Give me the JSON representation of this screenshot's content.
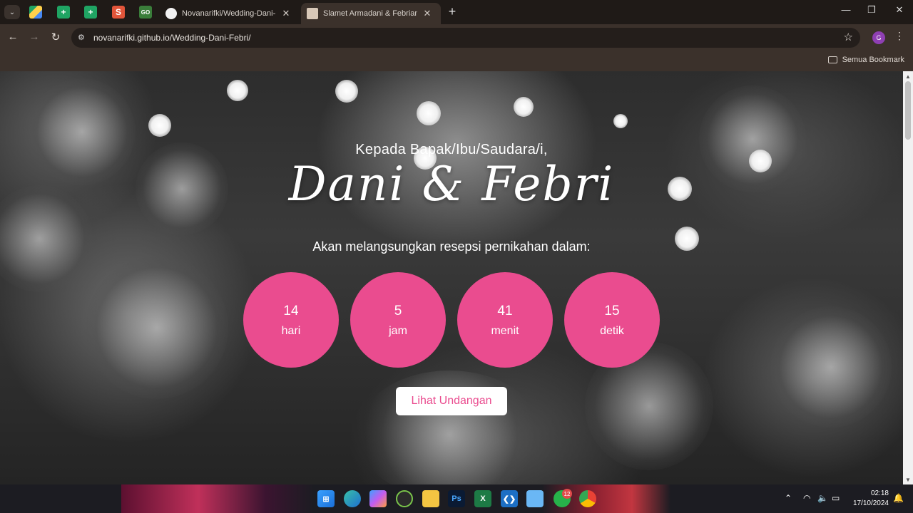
{
  "browser": {
    "tabs": [
      {
        "title": "Novanarifki/Wedding-Dani-Feb",
        "icon": "github-icon"
      },
      {
        "title": "Slamet Armadani & Febriana D",
        "icon": "page-icon"
      }
    ],
    "url": "novanarifki.github.io/Wedding-Dani-Febri/",
    "bookmarks_folder": "Semua Bookmark",
    "profile_initial": "G"
  },
  "hero": {
    "greeting": "Kepada Bapak/Ibu/Saudara/i,",
    "couple": "Dani & Febri",
    "announcement": "Akan melangsungkan resepsi pernikahan dalam:",
    "countdown": [
      {
        "value": "14",
        "unit": "hari"
      },
      {
        "value": "5",
        "unit": "jam"
      },
      {
        "value": "41",
        "unit": "menit"
      },
      {
        "value": "15",
        "unit": "detik"
      }
    ],
    "button": "Lihat Undangan",
    "accent_color": "#ea4c8f"
  },
  "taskbar": {
    "time": "02:18",
    "date": "17/10/2024",
    "whatsapp_badge": "12"
  }
}
